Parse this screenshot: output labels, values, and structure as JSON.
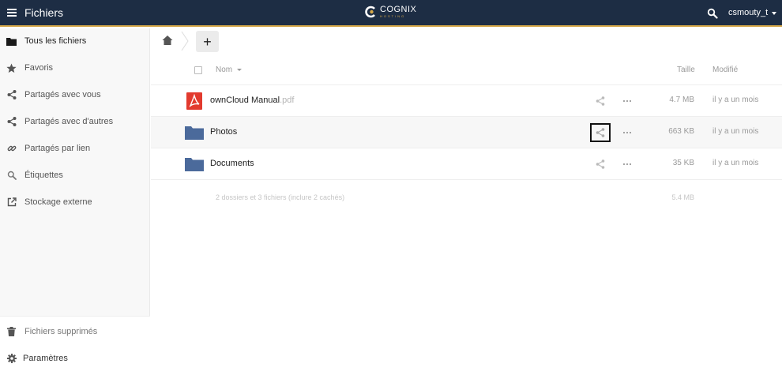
{
  "header": {
    "app_title": "Fichiers",
    "logo_text": "COGNIX",
    "logo_subtext": "HOSTING",
    "username": "csmouty_t",
    "bg_color": "#1d2d44",
    "accent_color": "#d6a94a"
  },
  "sidebar": {
    "items": [
      {
        "label": "Tous les fichiers",
        "icon": "folder-icon"
      },
      {
        "label": "Favoris",
        "icon": "star-icon"
      },
      {
        "label": "Partagés avec vous",
        "icon": "share-icon"
      },
      {
        "label": "Partagés avec d'autres",
        "icon": "share-icon"
      },
      {
        "label": "Partagés par lien",
        "icon": "link-icon"
      },
      {
        "label": "Étiquettes",
        "icon": "search-icon"
      },
      {
        "label": "Stockage externe",
        "icon": "external-storage-icon"
      }
    ],
    "bottom": [
      {
        "label": "Fichiers supprimés",
        "icon": "trash-icon"
      },
      {
        "label": "Paramètres",
        "icon": "gear-icon"
      }
    ]
  },
  "toolbar": {
    "new_label": "+"
  },
  "table": {
    "headers": {
      "name": "Nom",
      "size": "Taille",
      "modified": "Modifié"
    },
    "rows": [
      {
        "name": "ownCloud Manual",
        "ext": ".pdf",
        "type": "pdf",
        "size": "4.7 MB",
        "modified": "il y a un mois"
      },
      {
        "name": "Photos",
        "ext": "",
        "type": "folder",
        "size": "663 KB",
        "modified": "il y a un mois"
      },
      {
        "name": "Documents",
        "ext": "",
        "type": "folder",
        "size": "35 KB",
        "modified": "il y a un mois"
      }
    ],
    "summary": {
      "text": "2 dossiers et 3 fichiers (inclure 2 cachés)",
      "size": "5.4 MB"
    }
  }
}
